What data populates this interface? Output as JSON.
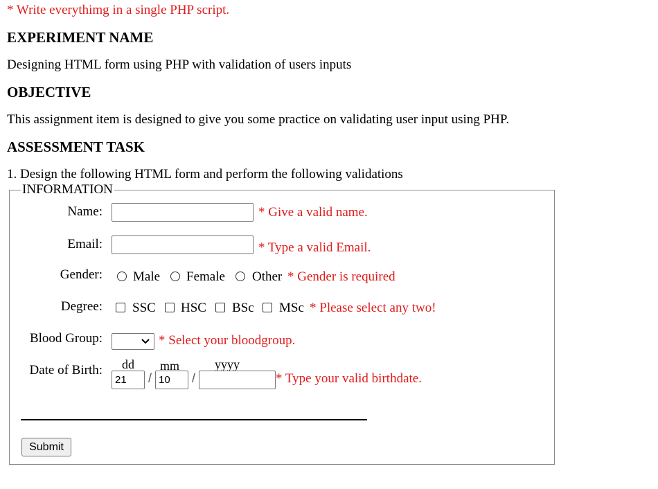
{
  "note": "* Write everythimg in a single PHP script.",
  "experiment": {
    "heading": "EXPERIMENT NAME",
    "text": "Designing HTML form using PHP with validation of users inputs"
  },
  "objective": {
    "heading": "OBJECTIVE",
    "text": "This assignment item is designed to give you some practice on validating user input using PHP."
  },
  "assessment": {
    "heading": "ASSESSMENT TASK",
    "text": "1. Design the following HTML form and perform the following validations"
  },
  "form": {
    "legend": "INFORMATION",
    "name": {
      "label": "Name:",
      "value": "",
      "error": "* Give a valid name."
    },
    "email": {
      "label": "Email:",
      "value": "",
      "error": "* Type a valid Email."
    },
    "gender": {
      "label": "Gender:",
      "options": [
        "Male",
        "Female",
        "Other"
      ],
      "error": "* Gender is required"
    },
    "degree": {
      "label": "Degree:",
      "options": [
        "SSC",
        "HSC",
        "BSc",
        "MSc"
      ],
      "error": "* Please select any two!"
    },
    "blood_group": {
      "label": "Blood Group:",
      "selected": "",
      "error": "* Select your bloodgroup."
    },
    "dob": {
      "label": "Date of Birth:",
      "dd_hint": "dd",
      "mm_hint": "mm",
      "yyyy_hint": "yyyy",
      "separator": "/",
      "dd_value": "21",
      "mm_value": "10",
      "yyyy_value": "",
      "error": "* Type your valid birthdate."
    },
    "submit_label": "Submit"
  },
  "colors": {
    "error": "#e01b1b",
    "border": "#8a8a8a",
    "button_bg": "#efefef"
  }
}
